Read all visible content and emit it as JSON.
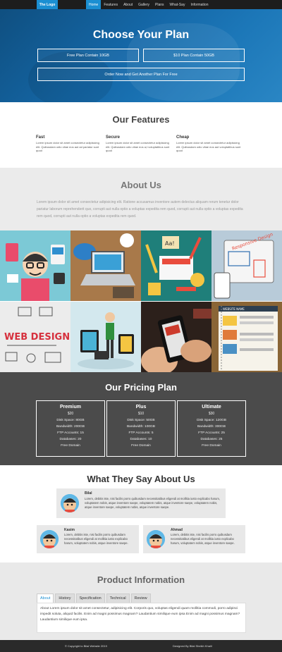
{
  "nav": {
    "logo": "The Logo",
    "links": [
      "Home",
      "Features",
      "About",
      "Gallery",
      "Plans",
      "What-Say",
      "Information"
    ]
  },
  "hero": {
    "title": "Choose Your Plan",
    "btn_free": "Free Plan Contain 10GB",
    "btn_ten": "$10 Plan Contain 50GB",
    "btn_order": "Order Now and Get Another Plan For Free"
  },
  "features": {
    "title": "Our Features",
    "items": [
      {
        "title": "Fast",
        "text": "Lorem ipsum dolor sit amet consectetur adipisicing elit. Quibusdam odio vitae eos aut ad pariatur sunt quod"
      },
      {
        "title": "Secure",
        "text": "Lorem ipsum dolor sit amet consectetur adipisicing elit. Quibusdam odio vitae eos a,t voluptatibus sunt quod"
      },
      {
        "title": "Cheap",
        "text": "Lorem ipsum dolor sit amet consectetur adipisicing elit. Quibusdam odio vitae eos aut voluptatibus sunt quod"
      }
    ]
  },
  "about": {
    "title": "About Us",
    "text": "Lorem ipsum dolor sit amet consectetur adipisicing elit. Ratione accusamus inventore autem delectus aliquam rerum tenetur dolor pariatur laborum reprehenderit quo, corrupti aut nulla optio a voluptas expedita rem quod, corrupti aut nulla optio a voluptas expedita rem quod, corrupti aut nulla optio a voluptas expedita rem quod."
  },
  "gallery": {
    "tiles": [
      {
        "icon": "people-illustration",
        "bg": "#7cc9d6"
      },
      {
        "icon": "laptop-desk-photo",
        "bg": "#b98955"
      },
      {
        "icon": "design-tools-illustration",
        "bg": "#2a8c86"
      },
      {
        "icon": "responsive-design-sketch",
        "bg": "#cbd8e4"
      },
      {
        "icon": "web-design-sketch",
        "bg": "#e8e8e8"
      },
      {
        "icon": "devices-figure-illustration",
        "bg": "#cfe6ec"
      },
      {
        "icon": "phone-hand-photo",
        "bg": "#3a2a22"
      },
      {
        "icon": "website-wireframe",
        "bg": "#7a5a33"
      }
    ],
    "labels": {
      "tile4": "Responsive Design",
      "tile5": "WEB DESIGN",
      "tile7": "WEBSITE NAME"
    }
  },
  "pricing": {
    "title": "Our Pricing Plan",
    "plans": [
      {
        "name": "Premium",
        "price": "$20",
        "lines": [
          "Disk Space: 80GB",
          "Bandwidth: 200GB",
          "FTP Accounts: 15",
          "Databases: 20",
          "Free Domain"
        ]
      },
      {
        "name": "Plus",
        "price": "$10",
        "lines": [
          "Disk Space: 50GB",
          "Bandwidth: 100GB",
          "FTP Accounts: 5",
          "Databases: 10",
          "Free Domain"
        ]
      },
      {
        "name": "Ultimate",
        "price": "$30",
        "lines": [
          "Disk Space: 120GB",
          "Bandwidth: 300GB",
          "FTP Accounts: 25",
          "Databases: 25",
          "Free Domain"
        ]
      }
    ]
  },
  "testimonials": {
    "title": "What They Say About Us",
    "items": [
      {
        "name": "Bilal",
        "text": "Lorem, debitis iste, nisi facilis porro quibusdam necessitatibus eligendi at mollitia iusto explicabo harum, voluptatem nobis, atque inventore saepe, voluptatem nobis, atque inventore saepe, voluptatem nobis, atque inventore saepe, voluptatem nobis, atque inventore saepe."
      },
      {
        "name": "Kasim",
        "text": "Lorem, debitis iste, nisi facilis porro quibusdam necessitatibus eligendi at mollitia iusto explicabo harum, voluptatem nobis, atque inventore saepe."
      },
      {
        "name": "Ahmad",
        "text": "Lorem, debitis iste, nisi facilis porro quibusdam necessitatibus eligendi at mollitia iusto explicabo harum, voluptatem nobis, atque inventore saepe."
      }
    ]
  },
  "product": {
    "title": "Product Information",
    "tabs": [
      "About",
      "History",
      "Specification",
      "Technical",
      "Review"
    ],
    "text": "About Lorem ipsum dolor sit amet consectetur, adipisicing elit. Corporis quo, voluptas eligendi quam mollitia commodi, porro adipisci impedit soluta, aliquid facilis. Enim ad magni possimus magnam? Laudantium similique eum ipsa Enim ad magni possimus magnam? Laudantium similique eum ipsa."
  },
  "footer": {
    "left": "© Copyright to Bilal Website 2019",
    "right": "Designed By Bilal Sheikh Khalil"
  },
  "colors": {
    "accent": "#1b8fd2",
    "pricing_bg": "#4b4b4b",
    "footer_bg": "#2a2a2a"
  }
}
